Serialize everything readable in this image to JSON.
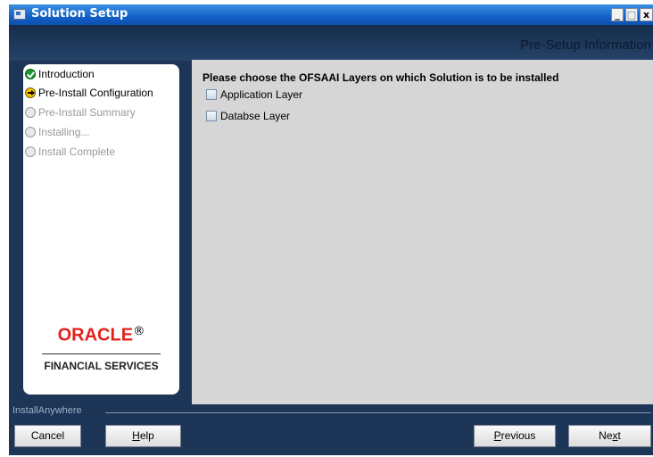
{
  "window": {
    "title": "Solution Setup",
    "controls": {
      "minimize": "_",
      "maximize": "□",
      "close": "x"
    }
  },
  "banner": {
    "title": "Pre-Setup Information"
  },
  "steps": [
    {
      "label": "Introduction",
      "state": "done"
    },
    {
      "label": "Pre-Install Configuration",
      "state": "current"
    },
    {
      "label": "Pre-Install Summary",
      "state": "pending"
    },
    {
      "label": "Installing...",
      "state": "pending"
    },
    {
      "label": "Install Complete",
      "state": "pending"
    }
  ],
  "logo": {
    "brand": "ORACLE",
    "subtitle": "FINANCIAL SERVICES"
  },
  "content": {
    "prompt": "Please choose the OFSAAI Layers on which Solution is to be installed",
    "options": [
      {
        "label": "Application Layer",
        "checked": false
      },
      {
        "label": "Databse Layer",
        "checked": false
      }
    ]
  },
  "footer": {
    "installer_label": "InstallAnywhere",
    "buttons": {
      "cancel": "Cancel",
      "help": {
        "mnemonic": "H",
        "rest": "elp"
      },
      "previous": {
        "mnemonic": "P",
        "rest": "revious"
      },
      "next": {
        "pre": "Ne",
        "mnemonic": "x",
        "rest": "t"
      }
    }
  },
  "colors": {
    "window_bg": "#1d3557",
    "titlebar": "#1460c8",
    "content_bg": "#d6d6d6",
    "oracle_red": "#e2231a"
  }
}
